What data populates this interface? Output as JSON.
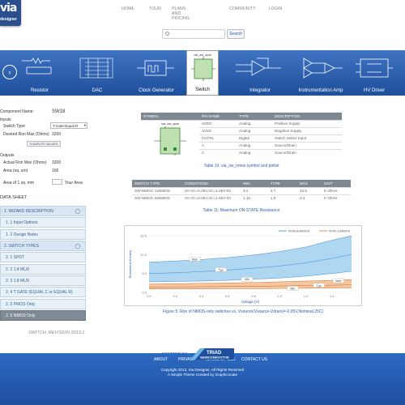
{
  "logo": {
    "big": "via",
    "small": "designer"
  },
  "nav": [
    "HOME",
    "TOUR",
    "PLANS AND PRICING",
    "COMMUNITY",
    "LOGIN"
  ],
  "search": {
    "placeholder": "",
    "button": "Search"
  },
  "carousel": {
    "items": [
      "Resistor",
      "DAC",
      "Clock Generator",
      "Switch",
      "Integrator",
      "Instrumentation Amp",
      "HV Driver"
    ],
    "selected_top_label": "via_sw_spst"
  },
  "component": {
    "name_label": "Component Name:",
    "name_value": "SW18",
    "inputs_heading": "Inputs",
    "switch_type_label": "Switch Type",
    "switch_type_value": "T-Gate-Equal R",
    "desired_ron_label": "Desired Ron Max (Ohms)",
    "desired_ron_value": "3200",
    "compute_button": "COMPUTE VALUES",
    "outputs_heading": "Outputs",
    "actual_ron_label": "Actual Ron Max (Ohms)",
    "actual_ron_value": "3200",
    "area_label": "Area (sq. um)",
    "area_value": "166",
    "area_mm_label": "Area of 1 sq. mm",
    "your_area_label": "Your Area"
  },
  "datasheet": {
    "heading": "DATA SHEET",
    "items": [
      "1. WIZARD DESCRIPTION",
      "1. 1 Input Options",
      "1. 2 Design Notes",
      "2. SWITCH TYPES",
      "2. 1 SPDT",
      "2. 2 1:4 MUX",
      "2. 3 1:8 MUX",
      "2. 4 T GATE (EQUAL C or EQUAL R)",
      "2. 5 PMOS Only",
      "2. 6 NMOS Only"
    ]
  },
  "pin_table": {
    "headers": [
      "SYMBOL",
      "PIN NAME",
      "TYPE",
      "DESCRIPTION"
    ],
    "symbol_label": "via_sw_spst",
    "rows": [
      [
        "AVDD",
        "Analog",
        "Positive Supply"
      ],
      [
        "AVSS",
        "Analog",
        "Negative Supply"
      ],
      [
        "CNTRL",
        "Digital",
        "Switch Select Input"
      ],
      [
        "A",
        "Analog",
        "Source/Drain"
      ],
      [
        "C",
        "Analog",
        "Source/Drain"
      ]
    ],
    "caption": "Table 10: via_sw_nmos symbol and pinlist"
  },
  "resistance_table": {
    "headers": [
      "SWITCH TYPE",
      "CONDITIONS",
      "MIN",
      "TYPE",
      "MAX",
      "UNIT"
    ],
    "rows": [
      [
        "SW-NMOS: 1xNMOS",
        "VA-VC=0.05V,VC=1.65V-0V",
        "3.2",
        "6.7",
        "10.5",
        "K Ohms"
      ],
      [
        "SW-NMOS: 8xNMOS",
        "VA-VC=0.05V,VC=1.65V-0V",
        "1.15",
        "1.9",
        "3.3",
        "K Ohms"
      ]
    ],
    "caption": "Table 11: Maximum ON-STATE Resistance"
  },
  "chart_data": {
    "type": "area",
    "legend": [
      "RON-8xNMOS",
      "RON-1xNMOS"
    ],
    "ylabel": "Resistance(Kohms)",
    "xlabel": "Voltage (V)",
    "ylim": [
      0,
      15
    ],
    "yticks": [
      "0.0",
      "5.0",
      "10.0",
      "15.0"
    ],
    "xticks": [
      "0.0",
      "0.2",
      "0.4",
      "0.6",
      "0.8",
      "1.0",
      "1.2",
      "1.4"
    ],
    "annotations": [
      "Max",
      "Typ",
      "Min",
      "Max",
      "Typ",
      "Min"
    ],
    "series": [
      {
        "name": "RON-8xNMOS",
        "color": "#6fb6e6",
        "x": [
          0.0,
          0.2,
          0.4,
          0.6,
          0.8,
          1.0,
          1.2,
          1.4,
          1.55
        ],
        "max": [
          8.0,
          8.3,
          8.7,
          9.2,
          9.9,
          10.8,
          12.0,
          13.8,
          15.0
        ],
        "typ": [
          5.0,
          5.2,
          5.5,
          5.9,
          6.4,
          7.0,
          7.8,
          9.0,
          10.0
        ],
        "min": [
          2.8,
          2.9,
          3.0,
          3.2,
          3.5,
          3.8,
          4.3,
          5.0,
          5.6
        ]
      },
      {
        "name": "RON-1xNMOS",
        "color": "#f0a060",
        "x": [
          0.0,
          0.2,
          0.4,
          0.6,
          0.8,
          1.0,
          1.2,
          1.4,
          1.55
        ],
        "max": [
          2.2,
          2.3,
          2.4,
          2.5,
          2.6,
          2.8,
          3.0,
          3.2,
          3.4
        ],
        "typ": [
          1.4,
          1.45,
          1.5,
          1.55,
          1.6,
          1.7,
          1.8,
          1.9,
          2.0
        ],
        "min": [
          0.9,
          0.92,
          0.95,
          0.98,
          1.0,
          1.05,
          1.1,
          1.15,
          1.2
        ]
      }
    ]
  },
  "figure_caption_line1": "Figure 5: Ron of NMOS-only switches vs. Vsource(Vsource-Vdrain)=-0.05V,Nominal,25C)",
  "revision": "SWITCH, REVISION 2013.1",
  "powered_by": "POWERED BY:",
  "triad": {
    "line1": "TRIAD",
    "line2": "SEMICONDUCTOR"
  },
  "footer": {
    "links": [
      "ABOUT",
      "PRIVACY",
      "TERMS OF USE",
      "CONTACT US"
    ],
    "copy1": "Copyright 2013, Via Designer, All Rights Reserved",
    "copy2": "A Simple Theme Created by Graphicnoate"
  }
}
